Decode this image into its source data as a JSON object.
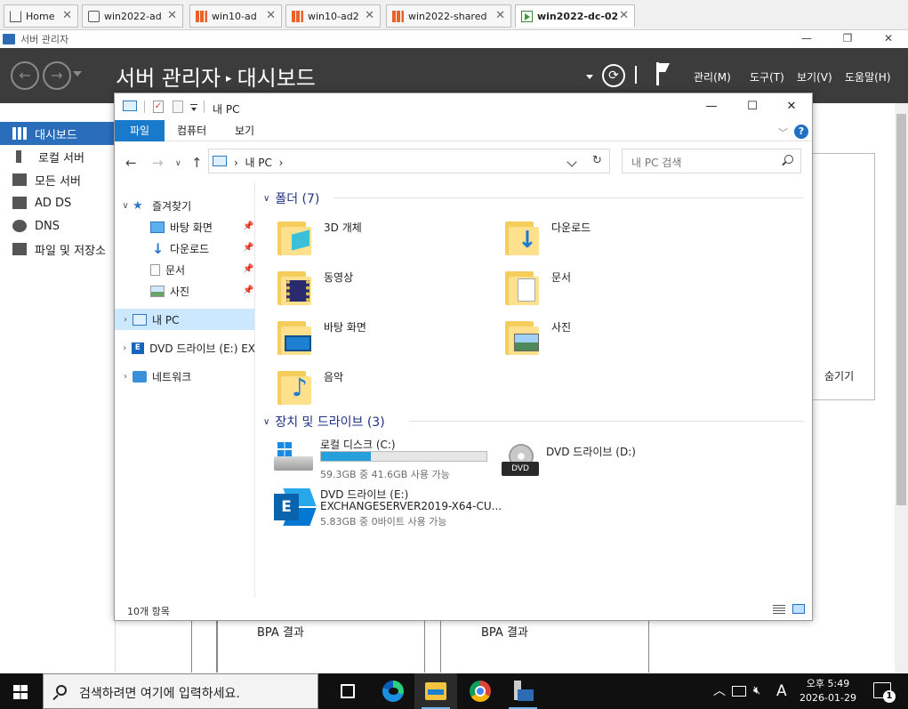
{
  "host_tabs": [
    {
      "label": "Home",
      "icon": "home-icon"
    },
    {
      "label": "win2022-ad",
      "icon": "vm-icon"
    },
    {
      "label": "win10-ad",
      "icon": "windows-vm-icon"
    },
    {
      "label": "win10-ad2",
      "icon": "windows-vm-icon"
    },
    {
      "label": "win2022-shared",
      "icon": "windows-vm-icon"
    },
    {
      "label": "win2022-dc-02",
      "icon": "running-vm-icon",
      "active": true
    }
  ],
  "server_manager": {
    "window_title": "서버 관리자",
    "breadcrumb_root": "서버 관리자",
    "breadcrumb_separator": "▸",
    "breadcrumb_page": "대시보드",
    "menus": [
      "관리(M)",
      "도구(T)",
      "보기(V)",
      "도움말(H)"
    ],
    "nav": [
      {
        "label": "대시보드",
        "icon": "dashboard-icon",
        "active": true
      },
      {
        "label": "로컬 서버",
        "icon": "server-icon"
      },
      {
        "label": "모든 서버",
        "icon": "servers-icon"
      },
      {
        "label": "AD DS",
        "icon": "ad-ds-icon"
      },
      {
        "label": "DNS",
        "icon": "dns-icon"
      },
      {
        "label": "파일 및 저장소",
        "icon": "storage-icon"
      }
    ],
    "hide_link": "숨기기",
    "bpa": [
      "BPA 결과",
      "BPA 결과"
    ]
  },
  "explorer": {
    "title": "내 PC",
    "ribbon_tabs": [
      "파일",
      "컴퓨터",
      "보기"
    ],
    "address": {
      "separator": "›",
      "location": "내 PC",
      "trailing": "›"
    },
    "search_placeholder": "내 PC 검색",
    "nav": {
      "quick_access": "즐겨찾기",
      "pinned": [
        "바탕 화면",
        "다운로드",
        "문서",
        "사진"
      ],
      "this_pc": "내 PC",
      "dvd_drive": "DVD 드라이브 (E:) EX",
      "network": "네트워크"
    },
    "folders_header": "폴더 (7)",
    "folders": [
      {
        "name": "3D 개체",
        "icon": "3d-objects-folder-icon"
      },
      {
        "name": "다운로드",
        "icon": "downloads-folder-icon"
      },
      {
        "name": "동영상",
        "icon": "videos-folder-icon"
      },
      {
        "name": "문서",
        "icon": "documents-folder-icon"
      },
      {
        "name": "바탕 화면",
        "icon": "desktop-folder-icon"
      },
      {
        "name": "사진",
        "icon": "pictures-folder-icon"
      },
      {
        "name": "음악",
        "icon": "music-folder-icon"
      }
    ],
    "drives_header": "장치 및 드라이브 (3)",
    "drives": [
      {
        "name": "로컬 디스크 (C:)",
        "detail": "59.3GB 중 41.6GB 사용 가능",
        "used_fraction": 0.3
      },
      {
        "name": "DVD 드라이브 (D:)",
        "badge": "DVD"
      },
      {
        "name": "DVD 드라이브 (E:)",
        "label_line": "EXCHANGESERVER2019-X64-CU...",
        "detail": "5.83GB 중 0바이트 사용 가능",
        "badge": "E"
      }
    ],
    "status": "10개 항목"
  },
  "taskbar": {
    "search_placeholder": "검색하려면 여기에 입력하세요.",
    "apps": [
      "task-view-icon",
      "edge-icon",
      "file-explorer-icon",
      "chrome-icon",
      "server-manager-icon"
    ],
    "ime": "A",
    "time": "오후 5:49",
    "date": "2026-01-29",
    "notification_count": "1"
  }
}
